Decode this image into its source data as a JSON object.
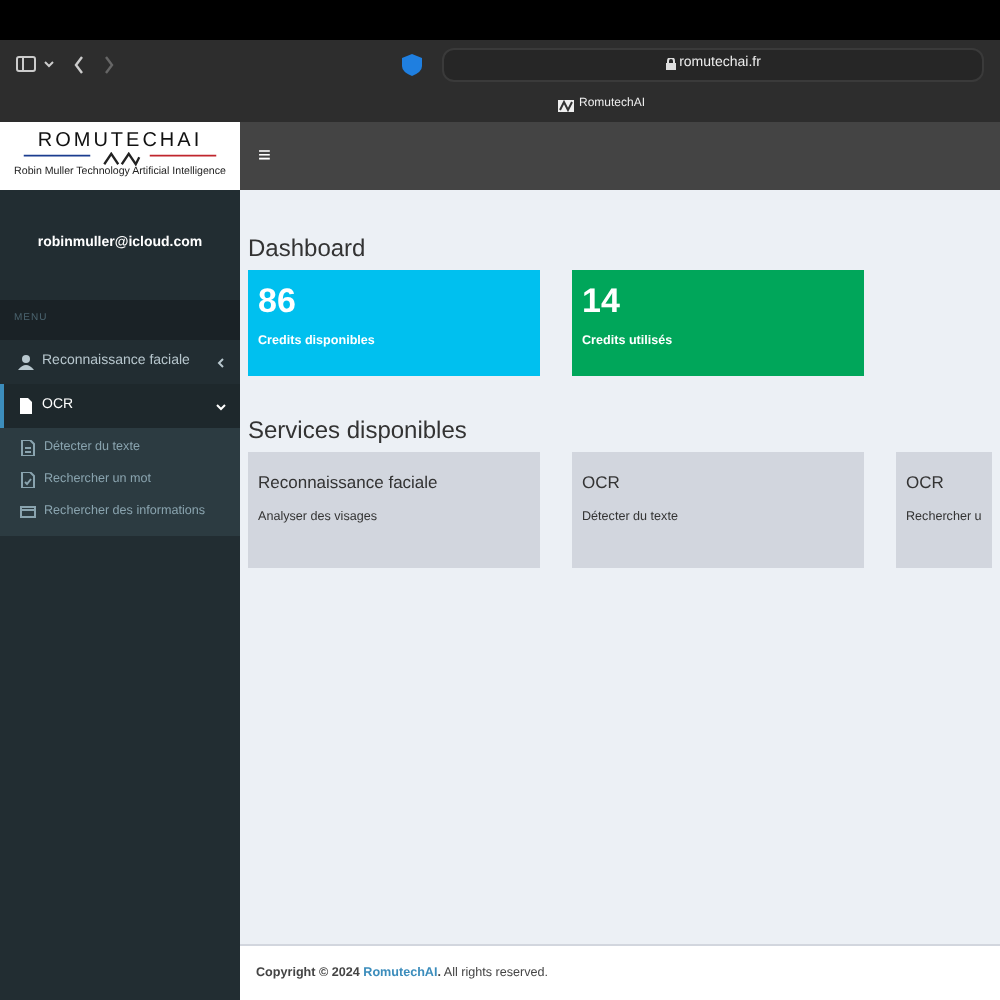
{
  "browser": {
    "url": "romutechai.fr",
    "tab_title": "RomutechAI"
  },
  "logo": {
    "title": "ROMUTECHAI",
    "subtitle": "Robin Muller Technology Artificial Intelligence"
  },
  "header": {
    "menu_toggle": "≡"
  },
  "sidebar": {
    "user": "robinmuller@icloud.com",
    "menu_header": "MENU",
    "items": [
      {
        "label": "Reconnaissance faciale",
        "kind": "face",
        "expanded": false,
        "selected": false
      },
      {
        "label": "OCR",
        "kind": "file",
        "expanded": true,
        "selected": true,
        "children": [
          {
            "label": "Détecter du texte",
            "kind": "doc"
          },
          {
            "label": "Rechercher un mot",
            "kind": "doccheck"
          },
          {
            "label": "Rechercher des informations",
            "kind": "card"
          }
        ]
      }
    ]
  },
  "dashboard": {
    "title": "Dashboard",
    "stats": [
      {
        "value": "86",
        "label": "Credits disponibles",
        "color": "#00c0ef"
      },
      {
        "value": "14",
        "label": "Credits utilisés",
        "color": "#00a65a"
      }
    ]
  },
  "services": {
    "title": "Services disponibles",
    "cards": [
      {
        "title": "Reconnaissance faciale",
        "description": "Analyser des visages"
      },
      {
        "title": "OCR",
        "description": "Détecter du texte"
      },
      {
        "title": "OCR",
        "description": "Rechercher u"
      }
    ]
  },
  "footer": {
    "before": "Copyright © 2024",
    "link": "RomutechAI",
    "link_end": ".",
    "after": " All rights reserved."
  }
}
